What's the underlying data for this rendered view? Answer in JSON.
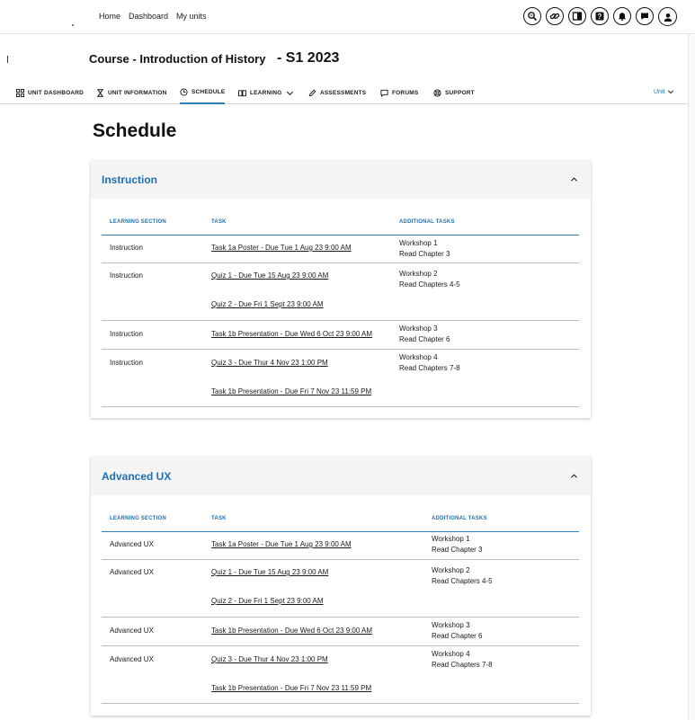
{
  "topnav": {
    "home": "Home",
    "dashboard": "Dashboard",
    "my_units": "My units"
  },
  "header_icons": [
    "search-zoom-icon",
    "link-icon",
    "book-icon",
    "help-icon",
    "bell-icon",
    "chat-icon",
    "user-icon"
  ],
  "course": {
    "title": "Course - Introduction of History",
    "term": "- S1 2023"
  },
  "unit_nav": {
    "items": [
      {
        "label": "UNIT DASHBOARD",
        "icon": "grid-icon"
      },
      {
        "label": "UNIT INFORMATION",
        "icon": "hourglass-icon"
      },
      {
        "label": "SCHEDULE",
        "icon": "clock-icon",
        "active": true
      },
      {
        "label": "LEARNING",
        "icon": "book-open-icon"
      },
      {
        "label": "ASSESSMENTS",
        "icon": "pencil-icon"
      },
      {
        "label": "FORUMS",
        "icon": "comment-icon"
      },
      {
        "label": "SUPPORT",
        "icon": "lifebuoy-icon"
      }
    ],
    "unit_select": "Unit"
  },
  "page_title": "Schedule",
  "accent": "#1f6fb2",
  "sections": [
    {
      "title": "Instruction",
      "headers": {
        "section": "LEARNING SECTION",
        "task": "TASK",
        "additional": "ADDITIONAL TASKS"
      },
      "rows": [
        {
          "section": "Instruction",
          "tasks": [
            "Task 1a Poster - Due Tue 1 Aug 23 9:00 AM"
          ],
          "additional": [
            "Workshop 1",
            "Read Chapter 3"
          ]
        },
        {
          "section": "Instruction",
          "tasks": [
            "Quiz 1 - Due Tue 15 Aug 23 9:00 AM",
            "Quiz 2 - Due Fri 1 Sept 23 9:00 AM"
          ],
          "additional": [
            "Workshop 2",
            "Read Chapters 4-5"
          ]
        },
        {
          "section": "Instruction",
          "tasks": [
            "Task 1b Presentation - Due Wed 6 Oct 23 9:00 AM"
          ],
          "additional": [
            "Workshop 3",
            "Read Chapter 6"
          ]
        },
        {
          "section": "Instruction",
          "tasks": [
            "Quiz 3 - Due Thur 4 Nov 23 1:00 PM",
            "Task 1b Presentation - Due Fri 7 Nov 23 11:59 PM"
          ],
          "additional": [
            "Workshop 4",
            "Read Chapters 7-8"
          ]
        }
      ]
    },
    {
      "title": "Advanced UX",
      "headers": {
        "section": "LEARNING SECTION",
        "task": "TASK",
        "additional": "ADDITIONAL TASKS"
      },
      "rows": [
        {
          "section": "Advanced UX",
          "tasks": [
            "Task 1a Poster - Due Tue 1 Aug 23 9:00 AM"
          ],
          "additional": [
            "Workshop 1",
            "Read Chapter 3"
          ]
        },
        {
          "section": "Advanced UX",
          "tasks": [
            "Quiz 1 - Due Tue 15 Aug 23 9:00 AM",
            "Quiz 2 - Due Fri 1 Sept 23 9:00 AM"
          ],
          "additional": [
            "Workshop 2",
            "Read Chapters 4-5"
          ]
        },
        {
          "section": "Advanced UX",
          "tasks": [
            "Task 1b Presentation - Due Wed 6 Oct 23 9:00 AM"
          ],
          "additional": [
            "Workshop 3",
            "Read Chapter 6"
          ]
        },
        {
          "section": "Advanced UX",
          "tasks": [
            "Quiz 3 - Due Thur 4 Nov 23 1:00 PM",
            "Task 1b Presentation - Due Fri 7 Nov 23 11:59 PM"
          ],
          "additional": [
            "Workshop 4",
            "Read Chapters 7-8"
          ]
        }
      ]
    }
  ]
}
